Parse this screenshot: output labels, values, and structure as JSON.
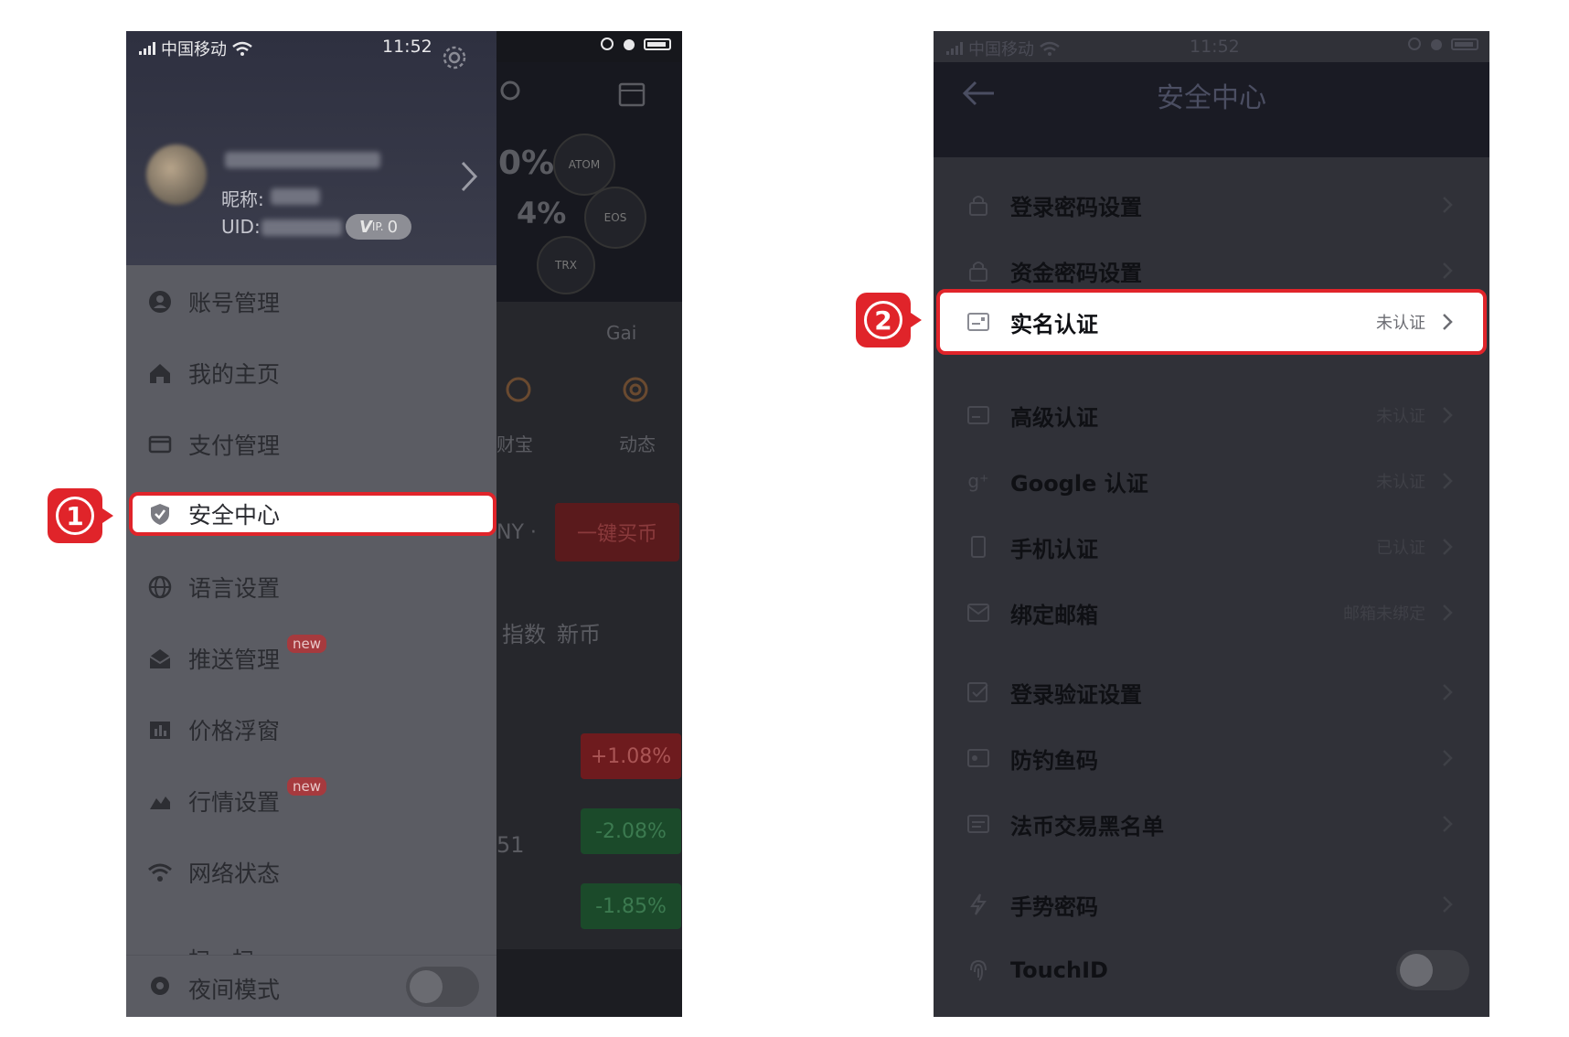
{
  "left_screen": {
    "status_bar": {
      "carrier": "中国移动",
      "time": "11:52"
    },
    "profile": {
      "nickname_label": "昵称:",
      "uid_label": "UID:",
      "vip": "V",
      "vip_level": "0"
    },
    "background_app": {
      "pct1": "0%",
      "pct2": "4%",
      "coin1": "ATOM",
      "coin2": "EOS",
      "coin3": "TRX",
      "gai": "Gai",
      "treasure": "财宝",
      "dynamic": "动态",
      "currency": "NY ·",
      "buy_button": "一键买币",
      "index_tab": "指数",
      "coin_tab": "新币",
      "change1": "+1.08%",
      "change2": "-2.08%",
      "change3": "-1.85%",
      "num": "51"
    },
    "menu": [
      {
        "label": "账号管理"
      },
      {
        "label": "我的主页"
      },
      {
        "label": "支付管理"
      },
      {
        "label": "安全中心"
      },
      {
        "label": "语言设置"
      },
      {
        "label": "推送管理",
        "badge": "new"
      },
      {
        "label": "价格浮窗"
      },
      {
        "label": "行情设置",
        "badge": "new"
      },
      {
        "label": "网络状态"
      }
    ],
    "partial_item": "扫一扫",
    "night_mode": "夜间模式",
    "step_number": "1"
  },
  "right_screen": {
    "status_bar": {
      "carrier": "中国移动",
      "time": "11:52"
    },
    "title": "安全中心",
    "rows": [
      {
        "label": "登录密码设置",
        "status": ""
      },
      {
        "label": "资金密码设置",
        "status": ""
      },
      {
        "label": "实名认证",
        "status": "未认证"
      },
      {
        "label": "高级认证",
        "status": "未认证"
      },
      {
        "label": "Google 认证",
        "status": "未认证"
      },
      {
        "label": "手机认证",
        "status": "已认证"
      },
      {
        "label": "绑定邮箱",
        "status": "邮箱未绑定"
      },
      {
        "label": "登录验证设置",
        "status": ""
      },
      {
        "label": "防钓鱼码",
        "status": ""
      },
      {
        "label": "法币交易黑名单",
        "status": ""
      },
      {
        "label": "手势密码",
        "status": ""
      },
      {
        "label": "TouchID",
        "status": ""
      }
    ],
    "step_number": "2"
  },
  "colors": {
    "highlight": "#e0242a",
    "new_badge": "#a63a3e"
  }
}
